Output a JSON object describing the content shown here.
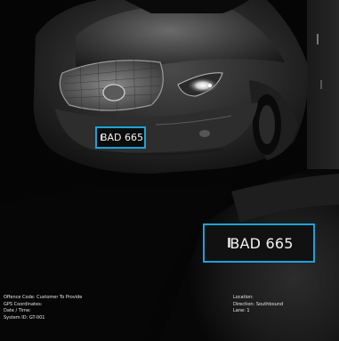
{
  "plate_small": {
    "text": "BAD 665"
  },
  "plate_large": {
    "text": "BAD 665"
  },
  "info_left": {
    "line1": "Offence Code: Customer To Provide",
    "line2": "GPS Coordinates:",
    "line3": "Date / Time:",
    "line4": "System ID: GT-001"
  },
  "info_right": {
    "line1": "Location:",
    "line2": "Direction: Southbound",
    "line3": "Lane: 1"
  },
  "colors": {
    "highlight_box": "#1aa3d9",
    "overlay_text": "#e6e6e6"
  }
}
